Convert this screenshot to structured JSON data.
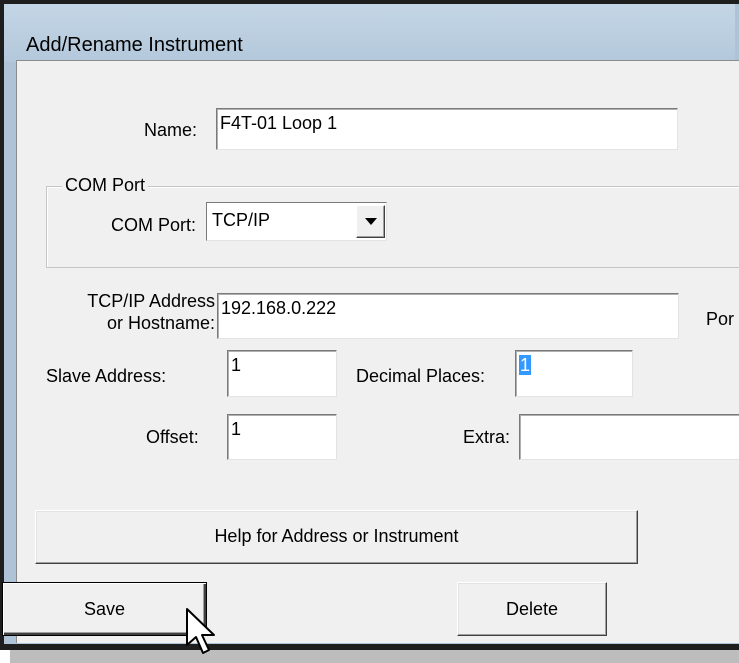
{
  "window": {
    "title": "Add/Rename Instrument"
  },
  "name_field": {
    "label": "Name:",
    "value": "F4T-01 Loop 1"
  },
  "com_group": {
    "title": "COM Port",
    "label": "COM Port:",
    "selected": "TCP/IP"
  },
  "tcp_field": {
    "label_line1": "TCP/IP Address",
    "label_line2": "or Hostname:",
    "value": "192.168.0.222"
  },
  "port_label": "Por",
  "slave_field": {
    "label": "Slave Address:",
    "value": "1"
  },
  "decimal_field": {
    "label": "Decimal Places:",
    "value": "1"
  },
  "offset_field": {
    "label": "Offset:",
    "value": "1"
  },
  "extra_field": {
    "label": "Extra:",
    "value": ""
  },
  "buttons": {
    "help": "Help for Address or  Instrument",
    "save": "Save",
    "delete": "Delete"
  },
  "icons": {
    "dropdown": "chevron-down-icon",
    "cursor": "mouse-pointer-icon"
  }
}
